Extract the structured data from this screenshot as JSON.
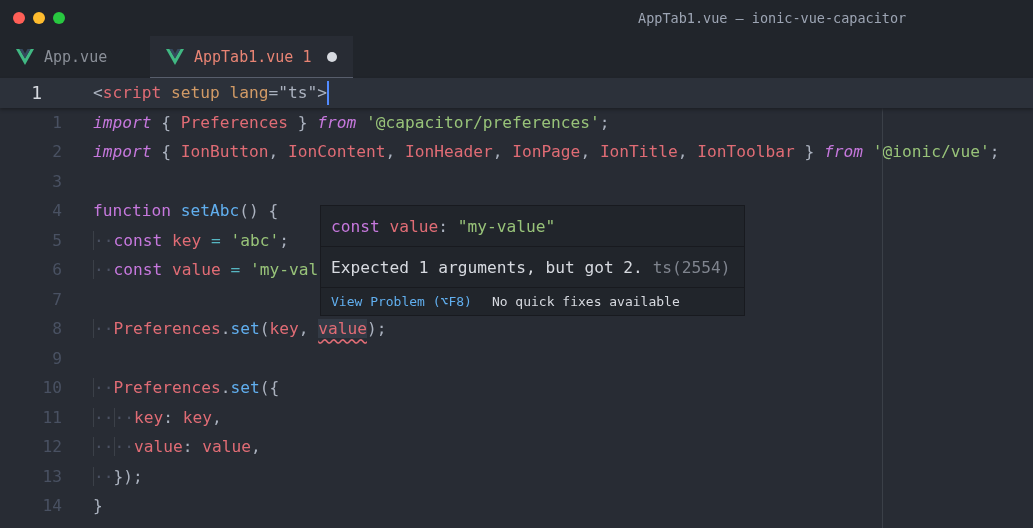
{
  "window": {
    "title": "AppTab1.vue — ionic-vue-capacitor"
  },
  "tabs": [
    {
      "label": "App.vue",
      "selected": false,
      "has_error": false,
      "modified": false
    },
    {
      "label": "AppTab1.vue",
      "problem_count": "1",
      "selected": true,
      "has_error": true,
      "modified": true
    }
  ],
  "editor": {
    "lines": [
      {
        "number": "1",
        "sticky": true,
        "tokens": [
          {
            "t": "<",
            "kind": "punct"
          },
          {
            "t": "script",
            "kind": "tag"
          },
          {
            "t": " setup",
            "kind": "attr"
          },
          {
            "t": " lang",
            "kind": "attr"
          },
          {
            "t": "=\"ts\">",
            "kind": "punct"
          }
        ]
      },
      {
        "number": "1",
        "sticky": false,
        "tokens": [
          {
            "t": "import",
            "kind": "keyword"
          },
          {
            "t": " { ",
            "kind": "punct"
          },
          {
            "t": "Preferences",
            "kind": "var"
          },
          {
            "t": " } ",
            "kind": "punct"
          },
          {
            "t": "from",
            "kind": "keyword"
          },
          {
            "t": " '@capacitor/preferences'",
            "kind": "string"
          },
          {
            "t": ";",
            "kind": "punct"
          }
        ]
      },
      {
        "number": "2",
        "sticky": false,
        "tokens": [
          {
            "t": "import",
            "kind": "keyword"
          },
          {
            "t": " { ",
            "kind": "punct"
          },
          {
            "t": "IonButton",
            "kind": "var"
          },
          {
            "t": ", ",
            "kind": "punct"
          },
          {
            "t": "IonContent",
            "kind": "var"
          },
          {
            "t": ", ",
            "kind": "punct"
          },
          {
            "t": "IonHeader",
            "kind": "var"
          },
          {
            "t": ", ",
            "kind": "punct"
          },
          {
            "t": "IonPage",
            "kind": "var"
          },
          {
            "t": ", ",
            "kind": "punct"
          },
          {
            "t": "IonTitle",
            "kind": "var"
          },
          {
            "t": ", ",
            "kind": "punct"
          },
          {
            "t": "IonToolbar",
            "kind": "var"
          },
          {
            "t": " } ",
            "kind": "punct"
          },
          {
            "t": "from",
            "kind": "keyword"
          },
          {
            "t": " '@ionic/vue'",
            "kind": "string"
          },
          {
            "t": ";",
            "kind": "punct"
          }
        ]
      },
      {
        "number": "3",
        "sticky": false
      },
      {
        "number": "4",
        "sticky": false,
        "tokens": [
          {
            "t": "function",
            "kind": "storage"
          },
          {
            "t": " setAbc",
            "kind": "fn"
          },
          {
            "t": "() {",
            "kind": "punct"
          }
        ]
      },
      {
        "number": "5",
        "sticky": false,
        "tokens": [
          {
            "t": "··",
            "kind": "ws"
          },
          {
            "t": "const",
            "kind": "storage"
          },
          {
            "t": " key",
            "kind": "var"
          },
          {
            "t": " = ",
            "kind": "op"
          },
          {
            "t": "'abc'",
            "kind": "string"
          },
          {
            "t": ";",
            "kind": "punct"
          }
        ]
      },
      {
        "number": "6",
        "sticky": false,
        "tokens": [
          {
            "t": "··",
            "kind": "ws"
          },
          {
            "t": "const",
            "kind": "storage"
          },
          {
            "t": " value",
            "kind": "var"
          },
          {
            "t": " = ",
            "kind": "op"
          },
          {
            "t": "'my-val",
            "kind": "string"
          }
        ]
      },
      {
        "number": "7",
        "sticky": false
      },
      {
        "number": "8",
        "sticky": false,
        "tokens": [
          {
            "t": "··",
            "kind": "ws"
          },
          {
            "t": "Preferences",
            "kind": "var"
          },
          {
            "t": ".",
            "kind": "punct"
          },
          {
            "t": "set",
            "kind": "fn"
          },
          {
            "t": "(",
            "kind": "punct"
          },
          {
            "t": "key",
            "kind": "var"
          },
          {
            "t": ", ",
            "kind": "punct"
          },
          {
            "t": "value",
            "kind": "var",
            "error": true
          },
          {
            "t": ");",
            "kind": "punct"
          }
        ]
      },
      {
        "number": "9",
        "sticky": false
      },
      {
        "number": "10",
        "sticky": false,
        "tokens": [
          {
            "t": "··",
            "kind": "ws"
          },
          {
            "t": "Preferences",
            "kind": "var"
          },
          {
            "t": ".",
            "kind": "punct"
          },
          {
            "t": "set",
            "kind": "fn"
          },
          {
            "t": "({",
            "kind": "punct"
          }
        ]
      },
      {
        "number": "11",
        "sticky": false,
        "tokens": [
          {
            "t": "··",
            "kind": "ws"
          },
          {
            "t": "··",
            "kind": "ws"
          },
          {
            "t": "key",
            "kind": "var"
          },
          {
            "t": ": ",
            "kind": "punct"
          },
          {
            "t": "key",
            "kind": "var"
          },
          {
            "t": ",",
            "kind": "punct"
          }
        ]
      },
      {
        "number": "12",
        "sticky": false,
        "tokens": [
          {
            "t": "··",
            "kind": "ws"
          },
          {
            "t": "··",
            "kind": "ws"
          },
          {
            "t": "value",
            "kind": "var"
          },
          {
            "t": ": ",
            "kind": "punct"
          },
          {
            "t": "value",
            "kind": "var"
          },
          {
            "t": ",",
            "kind": "punct"
          }
        ]
      },
      {
        "number": "13",
        "sticky": false,
        "tokens": [
          {
            "t": "··",
            "kind": "ws"
          },
          {
            "t": "});",
            "kind": "punct"
          }
        ]
      },
      {
        "number": "14",
        "sticky": false,
        "tokens": [
          {
            "t": "}",
            "kind": "punct"
          }
        ]
      }
    ]
  },
  "hover": {
    "signature": [
      {
        "t": "const",
        "kind": "storage"
      },
      {
        "t": " value",
        "kind": "var"
      },
      {
        "t": ": ",
        "kind": "punct"
      },
      {
        "t": "\"my-value\"",
        "kind": "string"
      }
    ],
    "message": "Expected 1 arguments, but got 2.",
    "code": "ts(2554)",
    "action": "View Problem (⌥F8)",
    "note": "No quick fixes available"
  }
}
